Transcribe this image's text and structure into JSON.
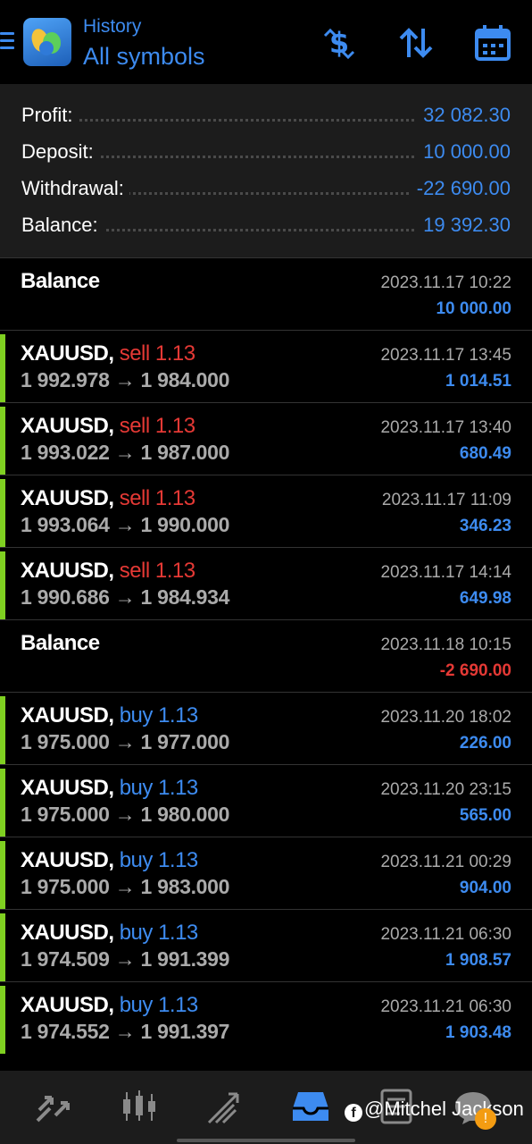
{
  "header": {
    "title": "History",
    "subtitle": "All symbols",
    "icons": [
      "menu-icon",
      "dollar-sign-icon",
      "sort-icon",
      "calendar-icon"
    ]
  },
  "summary": {
    "profit": {
      "label": "Profit:",
      "value": "32 082.30"
    },
    "deposit": {
      "label": "Deposit:",
      "value": "10 000.00"
    },
    "withdrawal": {
      "label": "Withdrawal:",
      "value": "-22 690.00"
    },
    "balance": {
      "label": "Balance:",
      "value": "19 392.30"
    }
  },
  "transactions": [
    {
      "type": "balance",
      "title": "Balance",
      "time": "2023.11.17 10:22",
      "amount": "10 000.00",
      "negative": false
    },
    {
      "type": "trade",
      "symbol": "XAUUSD,",
      "side": "sell",
      "volume": "1.13",
      "open": "1 992.978",
      "close": "1 984.000",
      "time": "2023.11.17 13:45",
      "amount": "1 014.51"
    },
    {
      "type": "trade",
      "symbol": "XAUUSD,",
      "side": "sell",
      "volume": "1.13",
      "open": "1 993.022",
      "close": "1 987.000",
      "time": "2023.11.17 13:40",
      "amount": "680.49"
    },
    {
      "type": "trade",
      "symbol": "XAUUSD,",
      "side": "sell",
      "volume": "1.13",
      "open": "1 993.064",
      "close": "1 990.000",
      "time": "2023.11.17 11:09",
      "amount": "346.23"
    },
    {
      "type": "trade",
      "symbol": "XAUUSD,",
      "side": "sell",
      "volume": "1.13",
      "open": "1 990.686",
      "close": "1 984.934",
      "time": "2023.11.17 14:14",
      "amount": "649.98"
    },
    {
      "type": "balance",
      "title": "Balance",
      "time": "2023.11.18 10:15",
      "amount": "-2 690.00",
      "negative": true
    },
    {
      "type": "trade",
      "symbol": "XAUUSD,",
      "side": "buy",
      "volume": "1.13",
      "open": "1 975.000",
      "close": "1 977.000",
      "time": "2023.11.20 18:02",
      "amount": "226.00"
    },
    {
      "type": "trade",
      "symbol": "XAUUSD,",
      "side": "buy",
      "volume": "1.13",
      "open": "1 975.000",
      "close": "1 980.000",
      "time": "2023.11.20 23:15",
      "amount": "565.00"
    },
    {
      "type": "trade",
      "symbol": "XAUUSD,",
      "side": "buy",
      "volume": "1.13",
      "open": "1 975.000",
      "close": "1 983.000",
      "time": "2023.11.21 00:29",
      "amount": "904.00"
    },
    {
      "type": "trade",
      "symbol": "XAUUSD,",
      "side": "buy",
      "volume": "1.13",
      "open": "1 974.509",
      "close": "1 991.399",
      "time": "2023.11.21 06:30",
      "amount": "1 908.57"
    },
    {
      "type": "trade",
      "symbol": "XAUUSD,",
      "side": "buy",
      "volume": "1.13",
      "open": "1 974.552",
      "close": "1 991.397",
      "time": "2023.11.21 06:30",
      "amount": "1 903.48"
    }
  ],
  "colors": {
    "accent": "#3d8bf0",
    "sell": "#e53935",
    "profit_bar": "#7fd021",
    "summary_bg": "#1c1c1c"
  },
  "bottom_nav": {
    "items": [
      "quotes-icon",
      "chart-icon",
      "trade-icon",
      "history-icon",
      "news-icon",
      "messages-icon"
    ],
    "watermark": "@Mitchel Jackson",
    "badge": "!"
  }
}
